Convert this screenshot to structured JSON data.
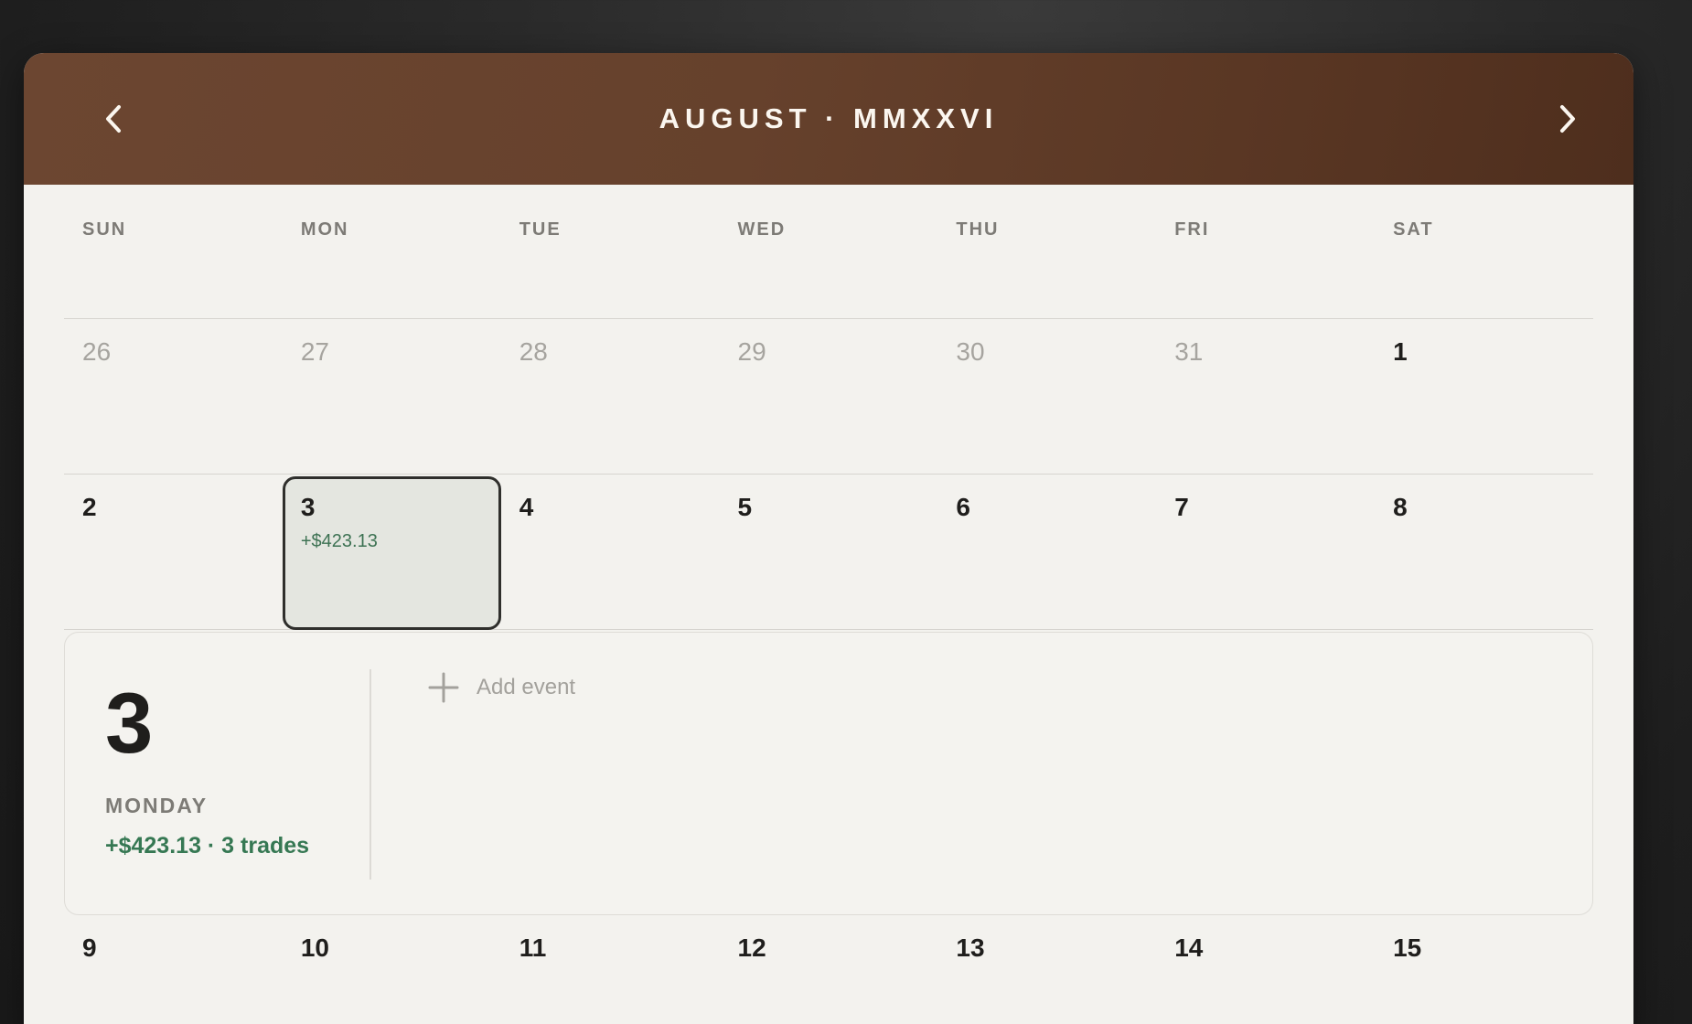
{
  "header": {
    "title": "AUGUST · MMXXVI",
    "prev_icon": "chevron-left-icon",
    "next_icon": "chevron-right-icon",
    "colors": {
      "header_bg": "#66412c",
      "title": "#fbf6ef"
    }
  },
  "weekdays": [
    "SUN",
    "MON",
    "TUE",
    "WED",
    "THU",
    "FRI",
    "SAT"
  ],
  "weeks": [
    [
      {
        "label": "26",
        "muted": true
      },
      {
        "label": "27",
        "muted": true
      },
      {
        "label": "28",
        "muted": true
      },
      {
        "label": "29",
        "muted": true
      },
      {
        "label": "30",
        "muted": true
      },
      {
        "label": "31",
        "muted": true
      },
      {
        "label": "1",
        "muted": false
      }
    ],
    [
      {
        "label": "2",
        "muted": false
      },
      {
        "label": "3",
        "muted": false,
        "selected": true,
        "pl": "+$423.13"
      },
      {
        "label": "4",
        "muted": false
      },
      {
        "label": "5",
        "muted": false
      },
      {
        "label": "6",
        "muted": false
      },
      {
        "label": "7",
        "muted": false
      },
      {
        "label": "8",
        "muted": false
      }
    ],
    [
      {
        "label": "9",
        "muted": false
      },
      {
        "label": "10",
        "muted": false
      },
      {
        "label": "11",
        "muted": false
      },
      {
        "label": "12",
        "muted": false
      },
      {
        "label": "13",
        "muted": false
      },
      {
        "label": "14",
        "muted": false
      },
      {
        "label": "15",
        "muted": false
      }
    ]
  ],
  "detail": {
    "day_number": "3",
    "weekday": "MONDAY",
    "summary": "+$423.13 · 3 trades",
    "add_event_label": "Add event",
    "add_icon": "plus-icon",
    "colors": {
      "profit": "#367853"
    }
  }
}
